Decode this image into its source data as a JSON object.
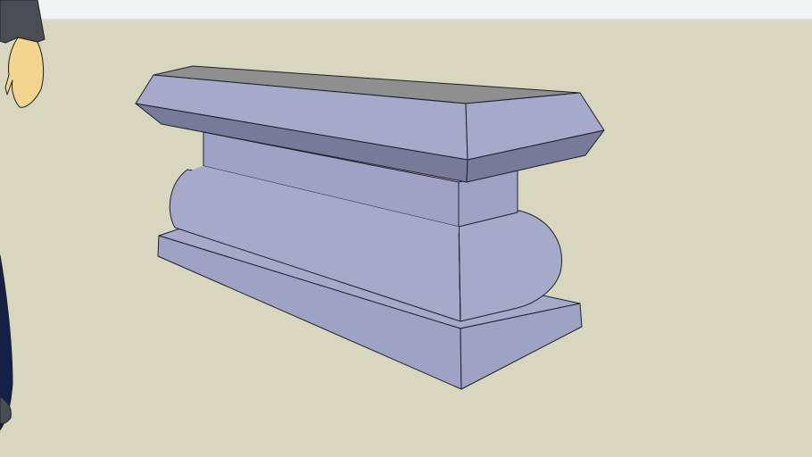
{
  "scene": {
    "colors": {
      "sky": "#f2f4f4",
      "horizon": "#d9dbdb",
      "ground": "#d9d6bf",
      "face_light": "#a5aacb",
      "face_mid": "#9ea3c6",
      "face_dark": "#777b9a",
      "face_top": "#8f8f90",
      "edge": "#1e1f2a",
      "figure_jacket": "#4b4d55",
      "figure_skin": "#f3d58f",
      "figure_pants": "#14204a"
    },
    "objects": [
      "pedestal-model",
      "scale-figure"
    ]
  }
}
